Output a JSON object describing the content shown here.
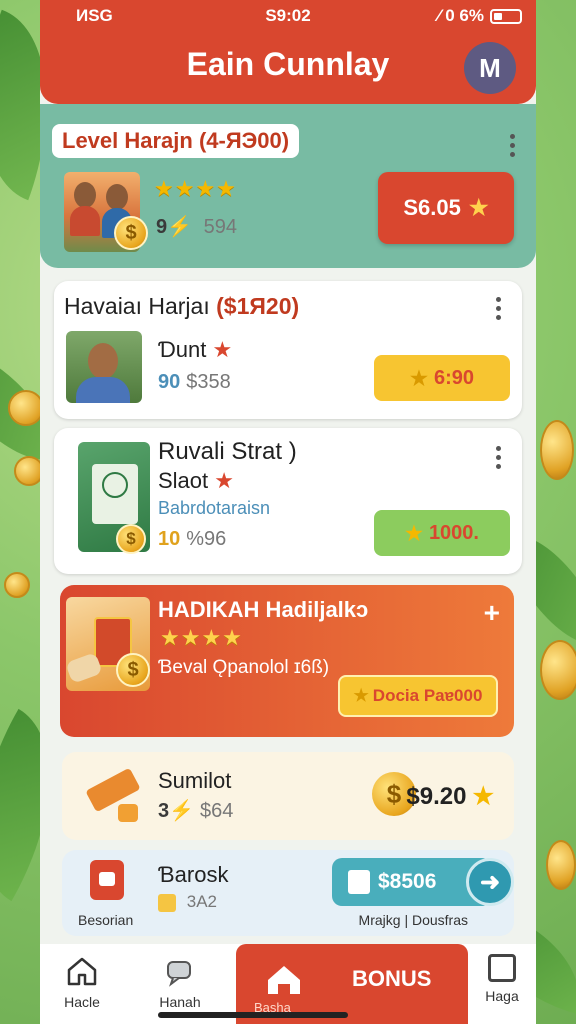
{
  "status_bar": {
    "left": "ИSG",
    "time": "S9:02",
    "right": "⁄ 0 6%"
  },
  "header": {
    "title": "Eain Cunnlay",
    "avatar_letter": "M"
  },
  "featured": {
    "level_title": "Level Harajn (4-ЯЭ00)",
    "stars": "★★★★",
    "coin_glyph": "$",
    "count": "9",
    "count_extra": "594",
    "button_label": "S6.05"
  },
  "card1": {
    "title": "Havaiaı Harjaı",
    "title_paren": "($1Я20)",
    "name": "Ɗunt",
    "stat_a": "90",
    "stat_b": "$358",
    "button_label": "6:90"
  },
  "card2": {
    "title": "Ruvali Strat )",
    "subtitle": "Slaot",
    "caption": "Babrdotaraisn",
    "stat_a": "10",
    "stat_b": "%96",
    "button_label": "1000."
  },
  "promo": {
    "title": "HADIKAH Hadiljalkɔ",
    "stars": "★★★★",
    "subtitle": "Ɓeval Ǫpanolol ɪ6ß)",
    "button_label": "Docia Paɐ000"
  },
  "card3": {
    "title": "Sumilot",
    "stat_a": "3",
    "stat_b": "$64",
    "price": "$9.20",
    "coin_glyph": "$"
  },
  "card4": {
    "title": "Ɓarosk",
    "stat_a": "3A2",
    "caption_left": "Besorian",
    "pill_label": "$8506",
    "caption_right": "Mrajkg | Dousfras"
  },
  "nav": {
    "home": "Hacle",
    "second": "Hanah",
    "bonus_sub": "Basha",
    "bonus": "BONUS",
    "last": "Haga"
  },
  "colors": {
    "primary": "#d9472f",
    "teal": "#78bba3",
    "accent_yellow": "#f7c531",
    "accent_green": "#8ccc5e",
    "accent_blue": "#49aebc"
  },
  "icons": [
    "avatar-icon",
    "more-vert-icon",
    "star-icon",
    "coin-icon",
    "plus-icon",
    "arrow-right-icon",
    "home-icon",
    "chat-icon",
    "bag-icon"
  ]
}
